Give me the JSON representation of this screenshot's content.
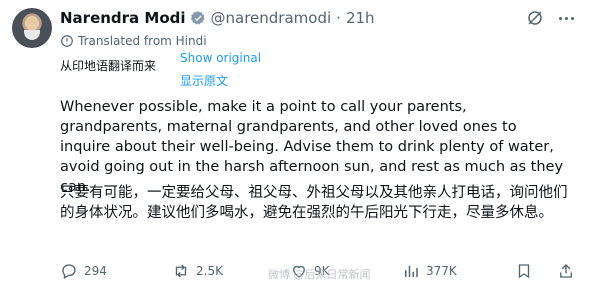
{
  "post": {
    "author_name": "Narendra Modi",
    "handle": "@narendramodi",
    "separator": "·",
    "time": "21h",
    "translated_from": "Translated from Hindi",
    "source_text_line1": "从印地语翻译而来",
    "show_original": "Show original",
    "source_text_line2": "显示原文",
    "body_en": "Whenever possible, make it a point to call your parents, grandparents, maternal grandparents, and other loved ones to inquire about their well-being. Advise them to drink plenty of water, avoid going out in the harsh afternoon sun, and rest as much as they can.",
    "body_zh": "只要有可能，一定要给父母、祖父母、外祖父母以及其他亲人打电话，询问他们的身体状况。建议他们多喝水，避免在强烈的午后阳光下行走，尽量多休息。"
  },
  "actions": {
    "replies": "294",
    "reposts": "2.5K",
    "likes": "9K",
    "views": "377K"
  },
  "watermark": "微博 @后来日常新闻",
  "icons": {
    "verified": "verified-badge-icon",
    "grok": "grok-icon",
    "more": "more-icon",
    "translate": "translate-icon",
    "reply": "reply-icon",
    "repost": "repost-icon",
    "like": "like-icon",
    "views": "views-icon",
    "bookmark": "bookmark-icon",
    "share": "share-icon"
  },
  "colors": {
    "accent": "#1d9bf0",
    "secondary_text": "#536471",
    "primary_text": "#0f1419"
  }
}
